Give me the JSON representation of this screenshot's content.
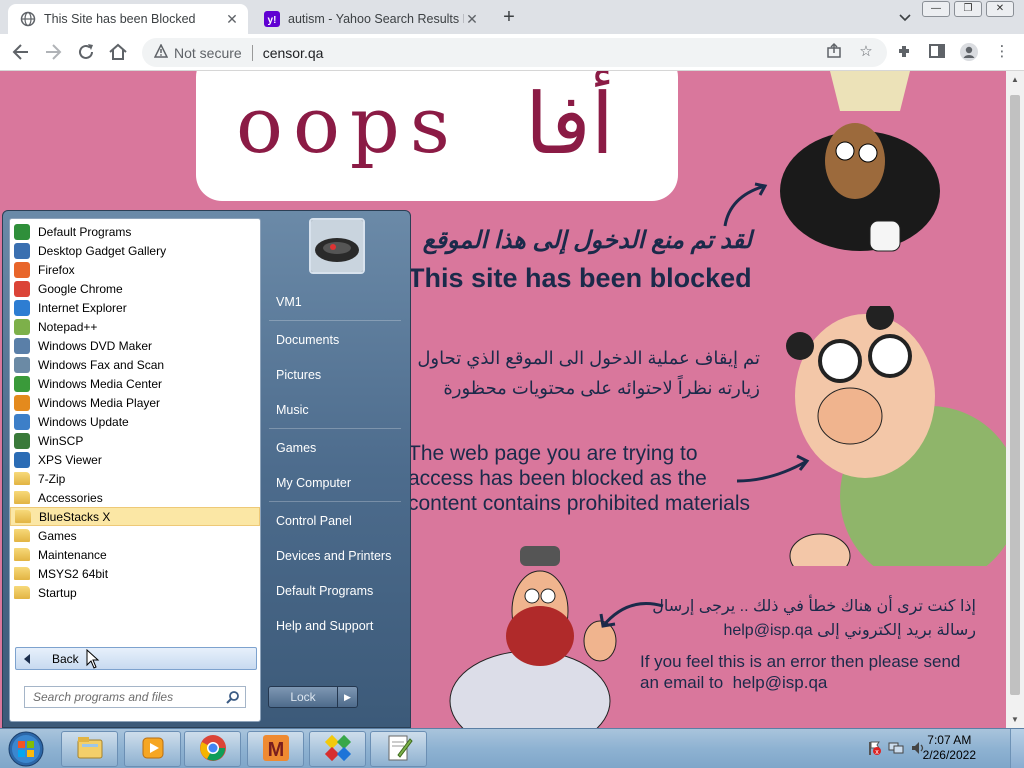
{
  "browser": {
    "tabs": [
      {
        "title": "This Site has been Blocked",
        "active": true
      },
      {
        "title": "autism - Yahoo Search Results Im",
        "active": false
      }
    ],
    "new_tab": "+",
    "omnibox": {
      "security": "Not secure",
      "url": "censor.qa"
    }
  },
  "page": {
    "oops": "oops",
    "oops_ar": "أفا",
    "ar_title": "لقد تم منع الدخول إلى هذا الموقع",
    "en_title": "This site has been blocked",
    "ar_body": "تم إيقاف عملية الدخول الى الموقع الذي تحاول زيارته نظراً لاحتوائه على محتويات محظورة",
    "en_body": "The web page you are trying to\naccess has been blocked as the\ncontent contains prohibited materials",
    "ar_footer": "إذا كنت ترى أن هناك خطأ في ذلك .. يرجى إرسال رسالة بريد إلكتروني إلى help@isp.qa",
    "en_footer": "If you feel this is an error then please send\nan email to  help@isp.qa"
  },
  "start_menu": {
    "programs": [
      {
        "label": "Default Programs",
        "icon": "default-programs-icon",
        "color": "#2f8f3a"
      },
      {
        "label": "Desktop Gadget Gallery",
        "icon": "gadget-gallery-icon",
        "color": "#3a6fb0"
      },
      {
        "label": "Firefox",
        "icon": "firefox-icon",
        "color": "#e8652a"
      },
      {
        "label": "Google Chrome",
        "icon": "chrome-icon",
        "color": "#db4437"
      },
      {
        "label": "Internet Explorer",
        "icon": "internet-explorer-icon",
        "color": "#2d7dd2"
      },
      {
        "label": "Notepad++",
        "icon": "notepad-plus-icon",
        "color": "#7db04a"
      },
      {
        "label": "Windows DVD Maker",
        "icon": "dvd-maker-icon",
        "color": "#5a7fa8"
      },
      {
        "label": "Windows Fax and Scan",
        "icon": "fax-scan-icon",
        "color": "#6b8aa5"
      },
      {
        "label": "Windows Media Center",
        "icon": "media-center-icon",
        "color": "#3a9a3a"
      },
      {
        "label": "Windows Media Player",
        "icon": "media-player-icon",
        "color": "#e48a1d"
      },
      {
        "label": "Windows Update",
        "icon": "windows-update-icon",
        "color": "#3d7fc8"
      },
      {
        "label": "WinSCP",
        "icon": "winscp-icon",
        "color": "#3a7a3a"
      },
      {
        "label": "XPS Viewer",
        "icon": "xps-viewer-icon",
        "color": "#2b6cb5"
      },
      {
        "label": "7-Zip",
        "icon": "folder-icon",
        "color": "folder"
      },
      {
        "label": "Accessories",
        "icon": "folder-icon",
        "color": "folder"
      },
      {
        "label": "BlueStacks X",
        "icon": "folder-icon",
        "color": "folder"
      },
      {
        "label": "Games",
        "icon": "folder-icon",
        "color": "folder"
      },
      {
        "label": "Maintenance",
        "icon": "folder-icon",
        "color": "folder"
      },
      {
        "label": "MSYS2 64bit",
        "icon": "folder-icon",
        "color": "folder"
      },
      {
        "label": "Startup",
        "icon": "folder-icon",
        "color": "folder"
      }
    ],
    "highlighted_index": 15,
    "back_label": "Back",
    "search_placeholder": "Search programs and files",
    "right_items": [
      {
        "label": "VM1",
        "group_end": true
      },
      {
        "label": "Documents",
        "group_end": false
      },
      {
        "label": "Pictures",
        "group_end": false
      },
      {
        "label": "Music",
        "group_end": true
      },
      {
        "label": "Games",
        "group_end": false
      },
      {
        "label": "My Computer",
        "group_end": true
      },
      {
        "label": "Control Panel",
        "group_end": false
      },
      {
        "label": "Devices and Printers",
        "group_end": false
      },
      {
        "label": "Default Programs",
        "group_end": false
      },
      {
        "label": "Help and Support",
        "group_end": false
      }
    ],
    "lock_label": "Lock"
  },
  "taskbar": {
    "apps": [
      {
        "name": "explorer-icon"
      },
      {
        "name": "media-player-icon"
      },
      {
        "name": "chrome-icon"
      },
      {
        "name": "msys2-icon"
      },
      {
        "name": "bluestacks-icon"
      },
      {
        "name": "notepad-plus-icon"
      }
    ],
    "time": "7:07 AM",
    "date": "2/26/2022"
  }
}
